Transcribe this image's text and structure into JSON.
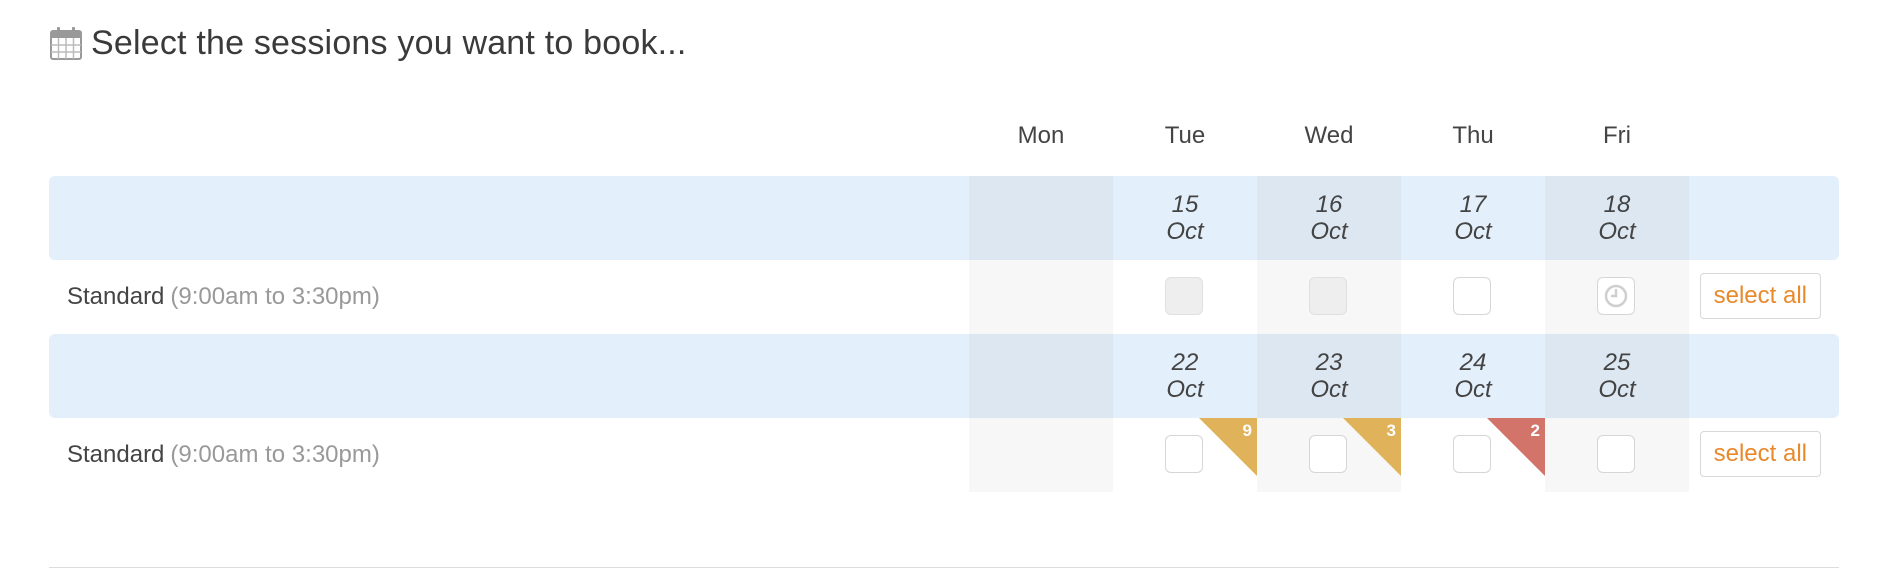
{
  "heading": {
    "icon": "calendar-icon",
    "title": "Select the sessions you want to book..."
  },
  "days": [
    "Mon",
    "Tue",
    "Wed",
    "Thu",
    "Fri"
  ],
  "weeks": [
    {
      "dates": [
        {
          "day": "",
          "month": ""
        },
        {
          "day": "15",
          "month": "Oct"
        },
        {
          "day": "16",
          "month": "Oct"
        },
        {
          "day": "17",
          "month": "Oct"
        },
        {
          "day": "18",
          "month": "Oct"
        }
      ],
      "session": {
        "name": "Standard",
        "time": "(9:00am to 3:30pm)",
        "select_all": "select all",
        "cells": [
          {
            "state": "none"
          },
          {
            "state": "disabled"
          },
          {
            "state": "disabled"
          },
          {
            "state": "available"
          },
          {
            "state": "waitlist",
            "icon": "clock-icon"
          }
        ]
      }
    },
    {
      "dates": [
        {
          "day": "",
          "month": ""
        },
        {
          "day": "22",
          "month": "Oct"
        },
        {
          "day": "23",
          "month": "Oct"
        },
        {
          "day": "24",
          "month": "Oct"
        },
        {
          "day": "25",
          "month": "Oct"
        }
      ],
      "session": {
        "name": "Standard",
        "time": "(9:00am to 3:30pm)",
        "select_all": "select all",
        "cells": [
          {
            "state": "none"
          },
          {
            "state": "available",
            "badge": "9",
            "badge_color": "#e0b25a"
          },
          {
            "state": "available",
            "badge": "3",
            "badge_color": "#e0b25a"
          },
          {
            "state": "available",
            "badge": "2",
            "badge_color": "#d27469"
          },
          {
            "state": "available"
          }
        ]
      }
    }
  ],
  "colors": {
    "accent": "#e8892c",
    "band": "#e3f0fb",
    "low_availability": "#e0b25a",
    "very_low_availability": "#d27469"
  }
}
